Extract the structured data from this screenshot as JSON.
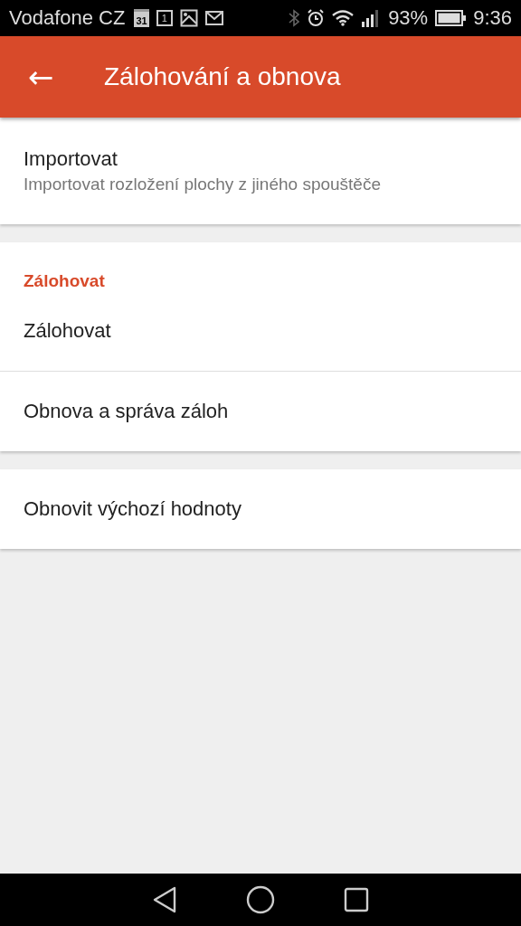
{
  "status_bar": {
    "carrier": "Vodafone CZ",
    "calendar_day": "31",
    "date_badge": "1",
    "battery": "93%",
    "time": "9:36"
  },
  "app_bar": {
    "back": "←",
    "title": "Zálohování a obnova"
  },
  "sections": [
    {
      "items": [
        {
          "title": "Importovat",
          "summary": "Importovat rozložení plochy z jiného spouštěče"
        }
      ]
    },
    {
      "header": "Zálohovat",
      "items": [
        {
          "title": "Zálohovat"
        },
        {
          "title": "Obnova a správa záloh"
        }
      ]
    },
    {
      "items": [
        {
          "title": "Obnovit výchozí hodnoty"
        }
      ]
    }
  ]
}
